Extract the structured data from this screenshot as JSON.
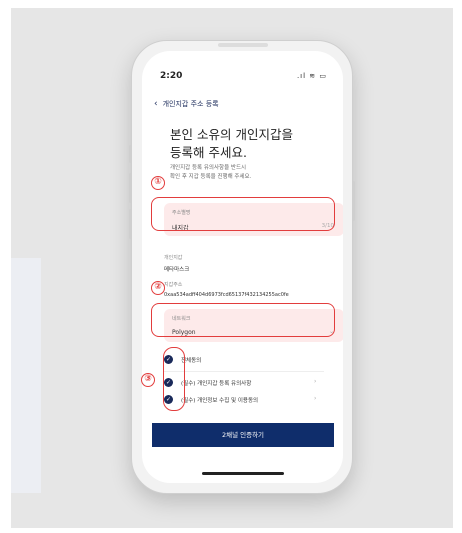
{
  "status_bar": {
    "time": "2:20",
    "indicators": ".ıl ≋ ▭"
  },
  "nav": {
    "back_icon": "chevron-left",
    "title": "개인지갑 주소 등록"
  },
  "headline": {
    "line1": "본인 소유의 개인지갑을",
    "line2": "등록해 주세요."
  },
  "subtext": {
    "line1": "개인지갑 등록 유의사항을 반드시",
    "line2": "확인 후 지갑 등록을 진행해 주세요."
  },
  "alias_field": {
    "label": "주소별명",
    "value": "내지갑",
    "counter": "3/10"
  },
  "wallet": {
    "label": "개인지갑",
    "value": "메타마스크"
  },
  "address": {
    "label": "지갑주소",
    "value": "0xaa534adff404d6973fcd65137f432134255ac0fe"
  },
  "network_field": {
    "label": "네트워크",
    "value": "Polygon"
  },
  "agreements": {
    "all": "전체동의",
    "items": [
      "(필수) 개인지갑 등록 유의사항",
      "(필수) 개인정보 수집 및 이용동의"
    ]
  },
  "cta_label": "2채널 인증하기",
  "markers": [
    "①",
    "②",
    "③"
  ],
  "colors": {
    "primary": "#0f2d6b",
    "highlight": "#e23d3d",
    "field_bg": "#fdeaea"
  }
}
